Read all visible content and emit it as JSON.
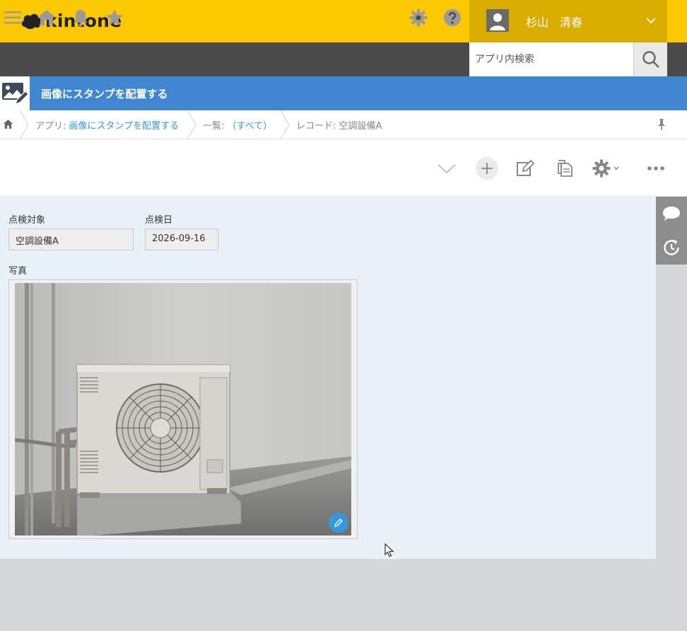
{
  "header": {
    "logo_text": "kintone",
    "user_name": "杉山　清春"
  },
  "navbar": {
    "search_placeholder": "アプリ内検索"
  },
  "app": {
    "title": "画像にスタンプを配置する"
  },
  "breadcrumb": {
    "app_prefix": "アプリ: ",
    "app_link": "画像にスタンプを配置する",
    "list_prefix": "一覧: ",
    "list_link": "（すべて）",
    "record": "レコード: 空調設備A"
  },
  "record": {
    "fields": [
      {
        "label": "点検対象",
        "value": "空調設備A"
      },
      {
        "label": "点検日",
        "value": "2026-09-16"
      }
    ],
    "photo_label": "写真"
  },
  "colors": {
    "header_yellow": "#fcc800",
    "user_box": "#d9ad00",
    "navbar": "#4b4b4b",
    "app_blue": "#4186d0",
    "link": "#3498db",
    "content_bg": "#e9f1f9"
  },
  "icons": {
    "navbar": [
      "menu-icon",
      "home-icon",
      "bell-icon",
      "star-icon",
      "gear-icon",
      "help-icon",
      "search-icon"
    ],
    "toolbar": [
      "chevron-down-icon",
      "plus-icon",
      "edit-icon",
      "copy-icon",
      "gear-icon",
      "more-icon"
    ],
    "side": [
      "comment-icon",
      "history-icon"
    ]
  }
}
